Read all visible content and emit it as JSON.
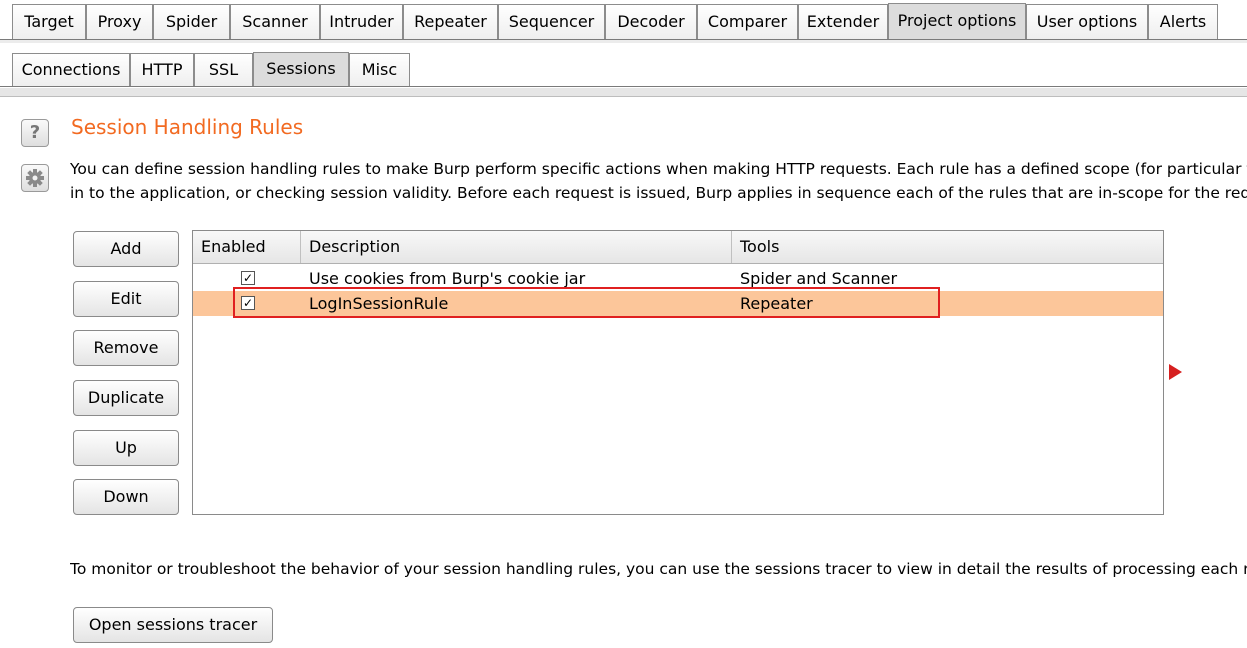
{
  "tabs_main": [
    "Target",
    "Proxy",
    "Spider",
    "Scanner",
    "Intruder",
    "Repeater",
    "Sequencer",
    "Decoder",
    "Comparer",
    "Extender",
    "Project options",
    "User options",
    "Alerts"
  ],
  "tabs_main_selected": "Project options",
  "tabs_sub": [
    "Connections",
    "HTTP",
    "SSL",
    "Sessions",
    "Misc"
  ],
  "tabs_sub_selected": "Sessions",
  "icons": {
    "help": "help-icon",
    "settings": "gear-icon"
  },
  "section": {
    "title": "Session Handling Rules",
    "desc_line1": "You can define session handling rules to make Burp perform specific actions when making HTTP requests. Each rule has a defined scope (for particular tools",
    "desc_line2": "in to the application, or checking session validity. Before each request is issued, Burp applies in sequence each of the rules that are in-scope for the request"
  },
  "buttons": {
    "add": "Add",
    "edit": "Edit",
    "remove": "Remove",
    "duplicate": "Duplicate",
    "up": "Up",
    "down": "Down"
  },
  "table": {
    "headers": {
      "enabled": "Enabled",
      "description": "Description",
      "tools": "Tools"
    },
    "rows": [
      {
        "enabled": true,
        "description": "Use cookies from Burp's cookie jar",
        "tools": "Spider and Scanner",
        "selected": false
      },
      {
        "enabled": true,
        "description": "LogInSessionRule",
        "tools": "Repeater",
        "selected": true
      }
    ]
  },
  "tracer": {
    "text": "To monitor or troubleshoot the behavior of your session handling rules, you can use the sessions tracer to view in detail the results of processing each rule.",
    "button": "Open sessions tracer"
  },
  "colors": {
    "accent_title": "#f26a21",
    "selected_row": "#fcc69a",
    "highlight_border": "#e02020",
    "arrow": "#d62020"
  }
}
